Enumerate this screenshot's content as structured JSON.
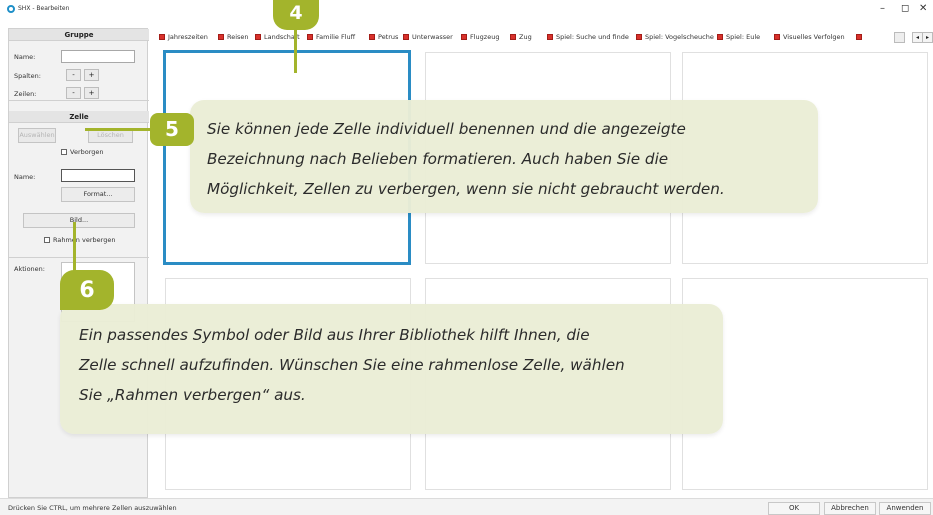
{
  "window": {
    "title": "SHX - Bearbeiten",
    "minimize": "–",
    "maximize": "◻",
    "close": "✕"
  },
  "gruppe": {
    "header": "Gruppe",
    "name_label": "Name:",
    "name_value": "",
    "spalten_label": "Spalten:",
    "zeilen_label": "Zeilen:",
    "minus": "-",
    "plus": "+"
  },
  "zelle": {
    "header": "Zelle",
    "btn_left": "Auswählen",
    "btn_right": "Löschen",
    "hidden_label": "Verborgen",
    "name_label": "Name:",
    "name_value": "",
    "format_button": "Format...",
    "image_button": "Bild...",
    "hide_frame_label": "Rahmen verbergen",
    "actions_label": "Aktionen:"
  },
  "tabs": [
    "Jahreszeiten",
    "Reisen",
    "Landschaft",
    "Familie Fluff",
    "Petrus",
    "Unterwasser",
    "Flugzeug",
    "Zug",
    "Spiel: Suche und finde",
    "Spiel: Vogelscheuche",
    "Spiel: Eule",
    "Visuelles Verfolgen"
  ],
  "status": {
    "hint": "Drücken Sie CTRL, um mehrere Zellen auszuwählen"
  },
  "dialog": {
    "ok": "OK",
    "cancel": "Abbrechen",
    "apply": "Anwenden"
  },
  "annotations": {
    "marker4": "4",
    "marker5": "5",
    "marker6": "6",
    "callout5": [
      "Sie können jede Zelle individuell benennen und die angezeigte",
      "Bezeichnung nach Belieben formatieren. Auch haben Sie die",
      "Möglichkeit, Zellen zu verbergen, wenn sie nicht gebraucht werden."
    ],
    "callout6": [
      "Ein passendes Symbol oder Bild aus Ihrer Bibliothek hilft Ihnen, die",
      "Zelle schnell aufzufinden. Wünschen Sie eine rahmenlose Zelle, wählen",
      "Sie „Rahmen verbergen“ aus."
    ]
  },
  "colors": {
    "accent": "#2a8cc4",
    "annotation_green": "#a3b42c",
    "callout_bg": "#eaedd6",
    "tab_icon": "#d9312b"
  }
}
